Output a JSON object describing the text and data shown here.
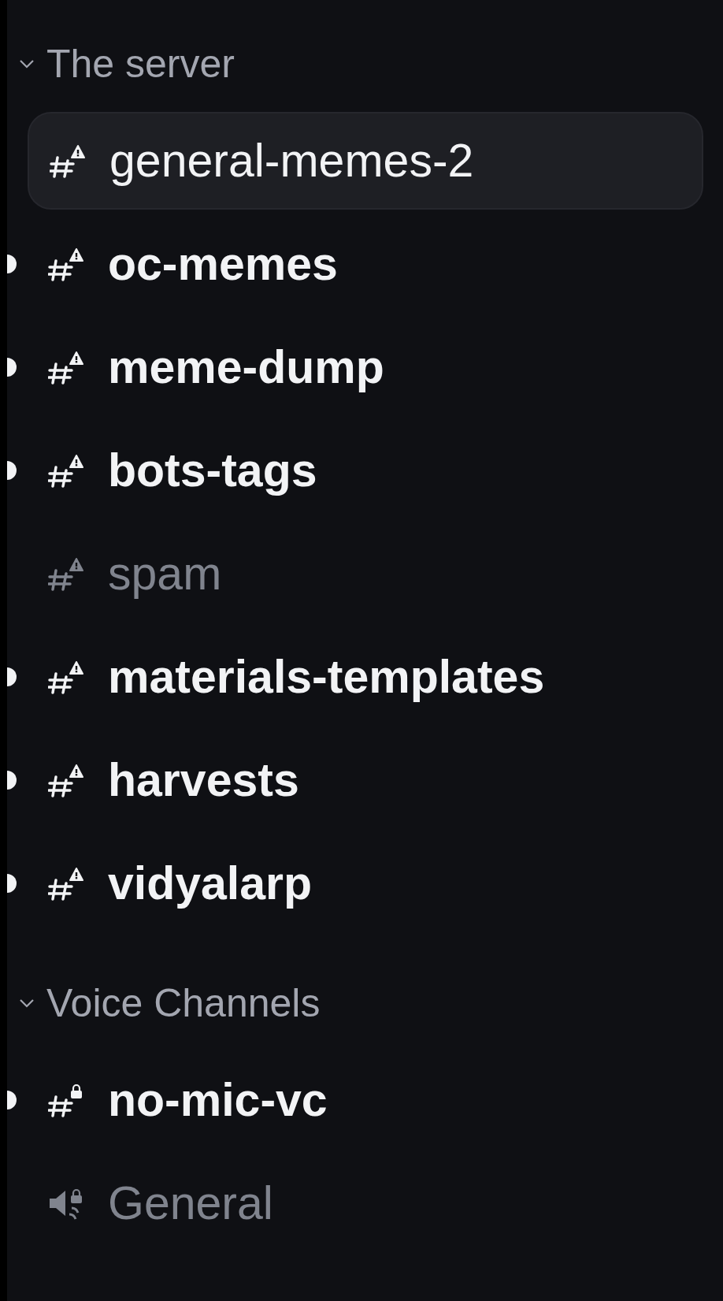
{
  "sections": [
    {
      "title": "The server",
      "expanded": true,
      "channels": [
        {
          "name": "general-memes-2",
          "kind": "restricted-text",
          "unread": false,
          "selected": true
        },
        {
          "name": "oc-memes",
          "kind": "restricted-text",
          "unread": true,
          "selected": false
        },
        {
          "name": "meme-dump",
          "kind": "restricted-text",
          "unread": true,
          "selected": false
        },
        {
          "name": "bots-tags",
          "kind": "restricted-text",
          "unread": true,
          "selected": false
        },
        {
          "name": "spam",
          "kind": "restricted-text",
          "unread": false,
          "selected": false
        },
        {
          "name": "materials-templates",
          "kind": "restricted-text",
          "unread": true,
          "selected": false
        },
        {
          "name": "harvests",
          "kind": "restricted-text",
          "unread": true,
          "selected": false
        },
        {
          "name": "vidyalarp",
          "kind": "restricted-text",
          "unread": true,
          "selected": false
        }
      ]
    },
    {
      "title": "Voice Channels",
      "expanded": true,
      "channels": [
        {
          "name": "no-mic-vc",
          "kind": "locked-text",
          "unread": true,
          "selected": false
        },
        {
          "name": "General",
          "kind": "locked-voice",
          "unread": false,
          "selected": false
        }
      ]
    }
  ]
}
